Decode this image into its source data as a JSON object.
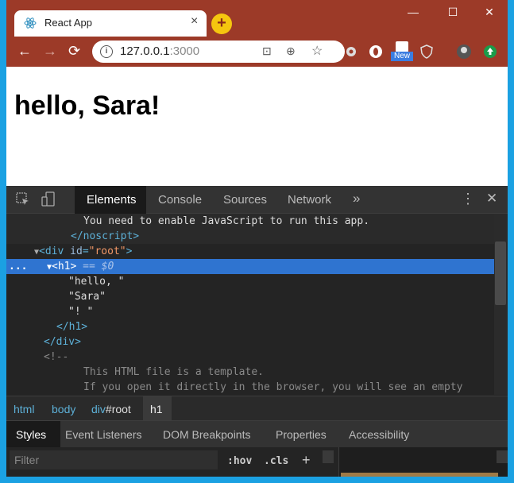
{
  "browser": {
    "tab_title": "React App",
    "tab_close": "×",
    "new_tab": "+",
    "window_controls": {
      "minimize": "—",
      "maximize": "☐",
      "close": "✕"
    },
    "nav": {
      "back": "←",
      "forward": "→",
      "reload": "⟳"
    },
    "url_host": "127.0.0.1",
    "url_port": ":3000",
    "extension_badge": "New"
  },
  "page": {
    "heading": "hello, Sara!"
  },
  "devtools": {
    "tabs": [
      "Elements",
      "Console",
      "Sources",
      "Network",
      "»"
    ],
    "menu_label": "⋮",
    "close_label": "✕",
    "dom": {
      "line1_text": "You need to enable JavaScript to run this app.",
      "line2_tag": "</noscript>",
      "line3_open": "<div ",
      "line3_attr": "id",
      "line3_val": "\"root\"",
      "line3_close": ">",
      "line4_tag": "<h1>",
      "line4_marker": " == $0",
      "line5_text": "\"hello, \"",
      "line6_text": "\"Sara\"",
      "line7_text": "\"! \"",
      "line8_tag": "</h1>",
      "line9_tag": "</div>",
      "line10_cmt": "<!--",
      "line11_cmt": "This HTML file is a template.",
      "line12_cmt": "If you open it directly in the browser, you will see an empty",
      "dots": "..."
    },
    "breadcrumbs": {
      "html": "html",
      "body": "body",
      "div": "div",
      "div_id": "#root",
      "h1": "h1"
    },
    "subtabs": [
      "Styles",
      "Event Listeners",
      "DOM Breakpoints",
      "Properties",
      "Accessibility"
    ],
    "filter_placeholder": "Filter",
    "hov": ":hov",
    "cls": ".cls",
    "plus": "+"
  }
}
